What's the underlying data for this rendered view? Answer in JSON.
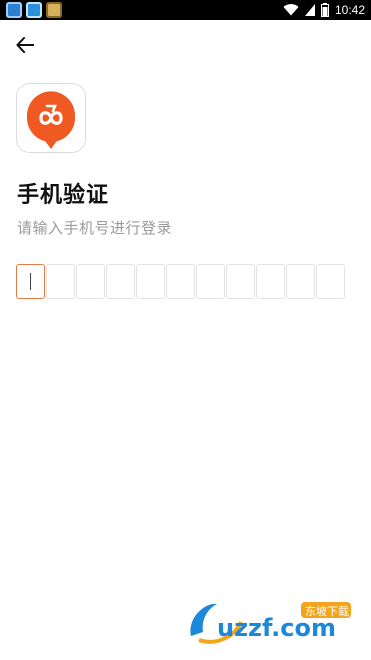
{
  "status_bar": {
    "time": "10:42",
    "icons": [
      "app-icon-1",
      "app-icon-2",
      "app-icon-3",
      "wifi-icon",
      "signal-icon",
      "battery-icon"
    ]
  },
  "header": {
    "back_icon": "arrow-left-icon"
  },
  "app": {
    "logo_icon": "bike-logo-icon",
    "brand_color": "#f05a22"
  },
  "title": "手机验证",
  "subtitle": "请输入手机号进行登录",
  "phone_input": {
    "box_count": 11,
    "value": "",
    "active_index": 0,
    "active_color": "#e87a45"
  },
  "watermark": {
    "text": "uzzf.com",
    "badge": "东坡下载"
  }
}
